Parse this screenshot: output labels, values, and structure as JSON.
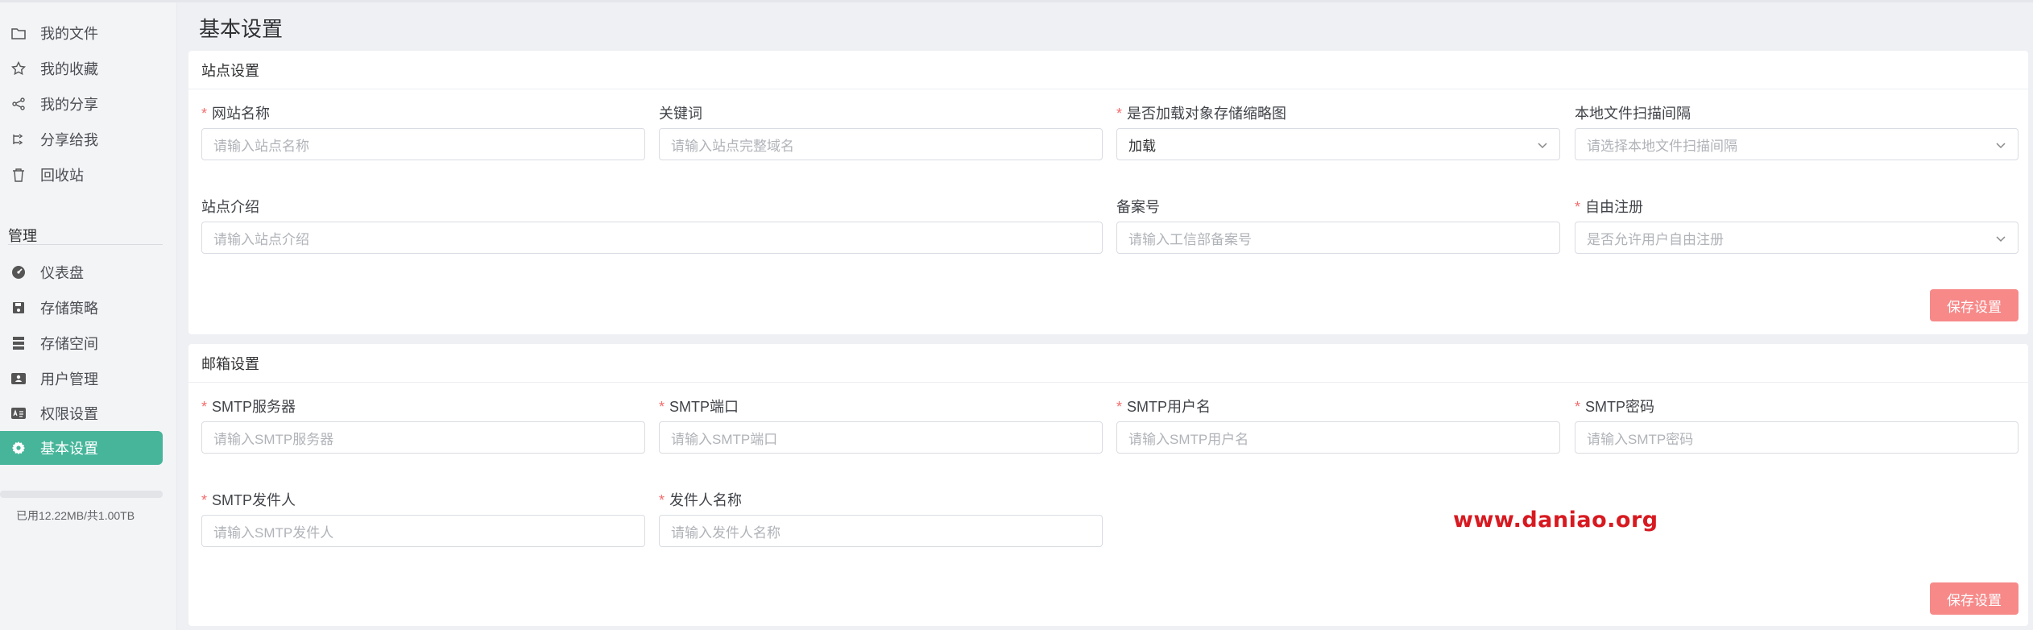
{
  "sidebar": {
    "items": [
      {
        "label": "我的文件",
        "icon": "folder-icon"
      },
      {
        "label": "我的收藏",
        "icon": "star-icon"
      },
      {
        "label": "我的分享",
        "icon": "share-icon"
      },
      {
        "label": "分享给我",
        "icon": "shared-with-me-icon"
      },
      {
        "label": "回收站",
        "icon": "trash-icon"
      }
    ],
    "admin_title": "管理",
    "admin_items": [
      {
        "label": "仪表盘",
        "icon": "dashboard-icon"
      },
      {
        "label": "存储策略",
        "icon": "storage-policy-icon"
      },
      {
        "label": "存储空间",
        "icon": "storage-space-icon"
      },
      {
        "label": "用户管理",
        "icon": "user-management-icon"
      },
      {
        "label": "权限设置",
        "icon": "permission-icon"
      },
      {
        "label": "基本设置",
        "icon": "gear-icon",
        "active": true
      }
    ],
    "storage": {
      "text": "已用12.22MB/共1.00TB",
      "used_fraction": 0.0
    }
  },
  "main": {
    "title": "基本设置",
    "site_settings": {
      "header": "站点设置",
      "fields": [
        {
          "label": "网站名称",
          "required": true,
          "placeholder": "请输入站点名称",
          "value": ""
        },
        {
          "label": "关键词",
          "required": false,
          "placeholder": "请输入站点完整域名",
          "value": ""
        },
        {
          "label": "是否加载对象存储缩略图",
          "required": true,
          "type": "select",
          "value": "加载"
        },
        {
          "label": "本地文件扫描间隔",
          "required": false,
          "type": "select",
          "placeholder": "请选择本地文件扫描间隔",
          "value": ""
        },
        {
          "label": "站点介绍",
          "required": false,
          "placeholder": "请输入站点介绍",
          "value": ""
        },
        {
          "label": "备案号",
          "required": false,
          "placeholder": "请输入工信部备案号",
          "value": ""
        },
        {
          "label": "自由注册",
          "required": true,
          "type": "select",
          "placeholder": "是否允许用户自由注册",
          "value": ""
        }
      ],
      "save_label": "保存设置"
    },
    "mail_settings": {
      "header": "邮箱设置",
      "fields": [
        {
          "label": "SMTP服务器",
          "required": true,
          "placeholder": "请输入SMTP服务器",
          "value": ""
        },
        {
          "label": "SMTP端口",
          "required": true,
          "placeholder": "请输入SMTP端口",
          "value": ""
        },
        {
          "label": "SMTP用户名",
          "required": true,
          "placeholder": "请输入SMTP用户名",
          "value": ""
        },
        {
          "label": "SMTP密码",
          "required": true,
          "placeholder": "请输入SMTP密码",
          "value": ""
        },
        {
          "label": "SMTP发件人",
          "required": true,
          "placeholder": "请输入SMTP发件人",
          "value": ""
        },
        {
          "label": "发件人名称",
          "required": true,
          "placeholder": "请输入发件人名称",
          "value": ""
        }
      ],
      "save_label": "保存设置"
    }
  },
  "watermark": "www.daniao.org",
  "colors": {
    "accent": "#46b59a",
    "danger_button": "#f78989",
    "required_star": "#f56c6c",
    "watermark": "#d71920"
  }
}
